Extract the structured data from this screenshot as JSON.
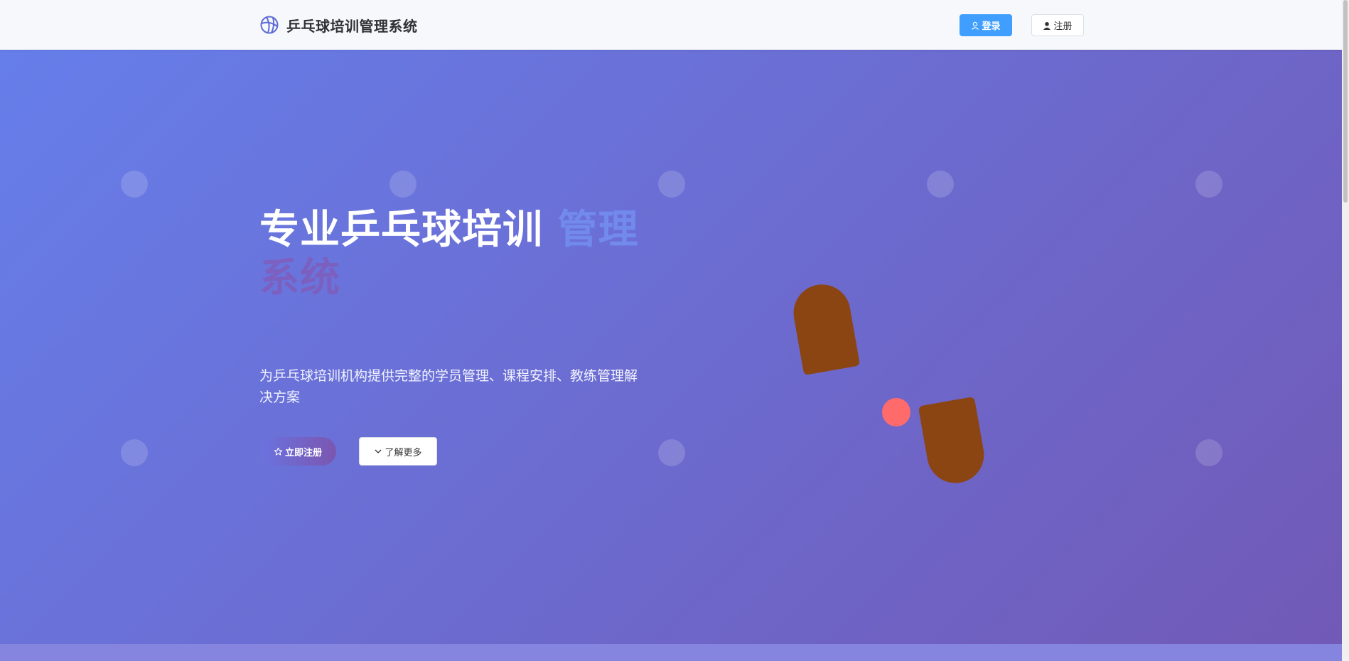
{
  "header": {
    "title": "乒乓球培训管理系统",
    "icon": "basketball-icon",
    "login_label": "登录",
    "register_label": "注册"
  },
  "hero": {
    "title_line": "专业乒乓球培训",
    "title_faded_1": "管理",
    "title_faded_2": "系统",
    "subtitle": "为乒乓球培训机构提供完整的学员管理、课程安排、教练管理解决方案",
    "cta_label": "立即注册",
    "more_label": "了解更多"
  },
  "colors": {
    "accent": "#409eff",
    "gradient_start": "#667eea",
    "gradient_end": "#764ba2",
    "paddle": "#8b4513",
    "ball": "#ff6b6b"
  }
}
